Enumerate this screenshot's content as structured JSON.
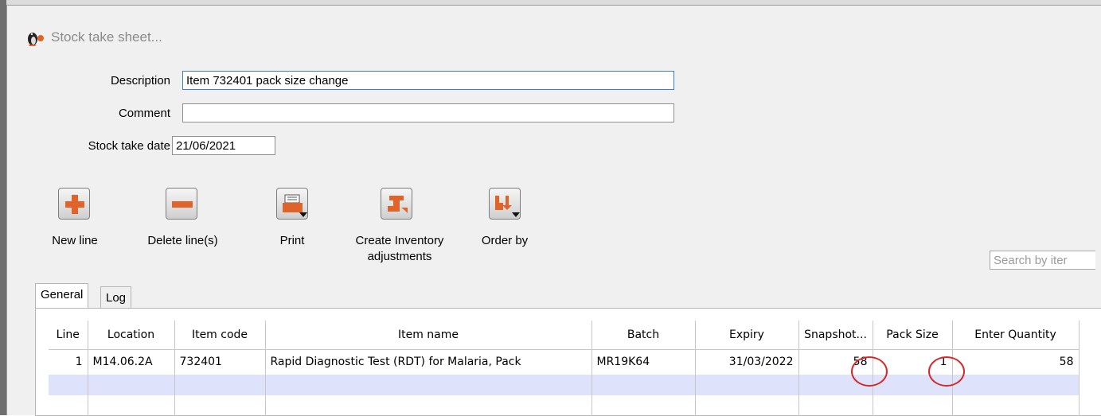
{
  "window": {
    "title": "Stock take sheet..."
  },
  "form": {
    "description_label": "Description",
    "description_value": "Item 732401 pack size change",
    "comment_label": "Comment",
    "comment_value": "",
    "date_label": "Stock take date",
    "date_value": "21/06/2021"
  },
  "toolbar": {
    "new_line": "New line",
    "delete_lines": "Delete line(s)",
    "print": "Print",
    "create_adjustments_1": "Create Inventory",
    "create_adjustments_2": "adjustments",
    "order_by": "Order by"
  },
  "search": {
    "placeholder": "Search by iter"
  },
  "tabs": [
    {
      "label": "General"
    },
    {
      "label": "Log"
    }
  ],
  "table": {
    "headers": [
      "Line",
      "Location",
      "Item code",
      "Item name",
      "Batch",
      "Expiry",
      "Snapshot...",
      "Pack Size",
      "Enter Quantity"
    ],
    "rows": [
      [
        "1",
        "M14.06.2A",
        "732401",
        "Rapid Diagnostic Test (RDT) for Malaria, Pack",
        "MR19K64",
        "31/03/2022",
        "58",
        "1",
        "58"
      ]
    ]
  },
  "colors": {
    "accent": "#e0632a",
    "selected_row": "#dfe2fb",
    "highlight_circle": "#d42a2a"
  },
  "icons": [
    "penguin-app-icon",
    "plus-icon",
    "minus-icon",
    "printer-icon",
    "inventory-adjust-icon",
    "sort-order-icon"
  ]
}
